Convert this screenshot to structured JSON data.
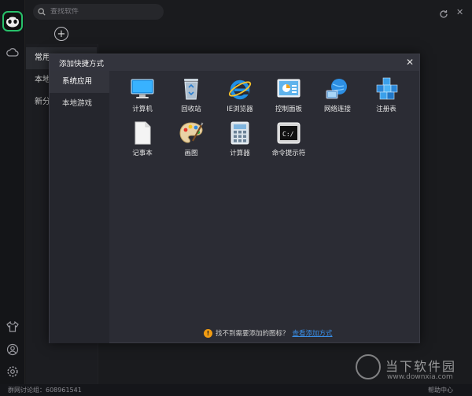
{
  "search": {
    "placeholder": "查找软件"
  },
  "background_nav": [
    "常用",
    "本地",
    "新分"
  ],
  "footer": {
    "qq_group": "群网讨论组：608961541",
    "help": "帮助中心"
  },
  "watermark": {
    "brand": "当下软件园",
    "url": "www.downxia.com"
  },
  "dialog": {
    "title": "添加快捷方式",
    "tabs": [
      {
        "label": "系统应用",
        "active": true
      },
      {
        "label": "本地游戏",
        "active": false
      }
    ],
    "apps": [
      {
        "label": "计算机",
        "icon": "computer-icon"
      },
      {
        "label": "回收站",
        "icon": "recycle-bin-icon"
      },
      {
        "label": "IE浏览器",
        "icon": "ie-browser-icon"
      },
      {
        "label": "控制面板",
        "icon": "control-panel-icon"
      },
      {
        "label": "网络连接",
        "icon": "network-icon"
      },
      {
        "label": "注册表",
        "icon": "registry-icon"
      },
      {
        "label": "记事本",
        "icon": "notepad-icon"
      },
      {
        "label": "画图",
        "icon": "paint-icon"
      },
      {
        "label": "计算器",
        "icon": "calculator-icon"
      },
      {
        "label": "命令提示符",
        "icon": "command-prompt-icon"
      }
    ],
    "hint_text": "找不到需要添加的图标？",
    "hint_link": "查看添加方式"
  },
  "colors": {
    "accent_green": "#27c16a",
    "link_blue": "#3a8ee6",
    "warn_orange": "#f29c11"
  }
}
